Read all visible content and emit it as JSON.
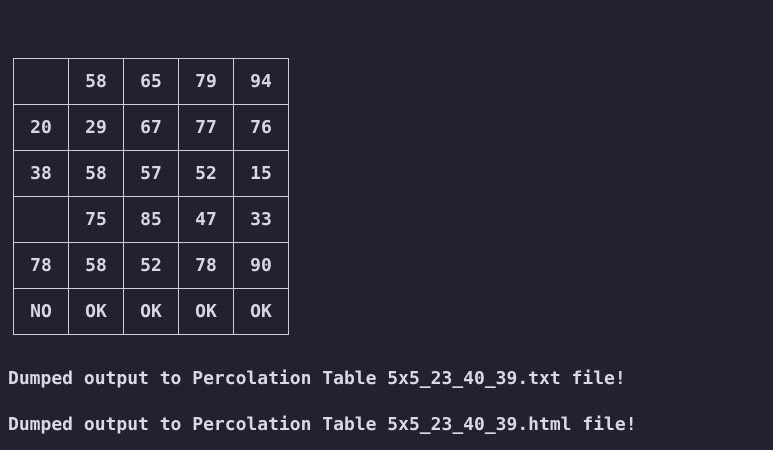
{
  "table": {
    "rows": [
      [
        "",
        "58",
        "65",
        "79",
        "94"
      ],
      [
        "20",
        "29",
        "67",
        "77",
        "76"
      ],
      [
        "38",
        "58",
        "57",
        "52",
        "15"
      ],
      [
        "",
        "75",
        "85",
        "47",
        "33"
      ],
      [
        "78",
        "58",
        "52",
        "78",
        "90"
      ],
      [
        "NO",
        "OK",
        "OK",
        "OK",
        "OK"
      ]
    ]
  },
  "output": {
    "txt_message": "Dumped output to Percolation Table 5x5_23_40_39.txt file!",
    "html_message": "Dumped output to Percolation Table 5x5_23_40_39.html file!"
  },
  "colors": {
    "background": "#23212f",
    "text": "#d7d6e4",
    "grid_border": "#cfcdda"
  }
}
